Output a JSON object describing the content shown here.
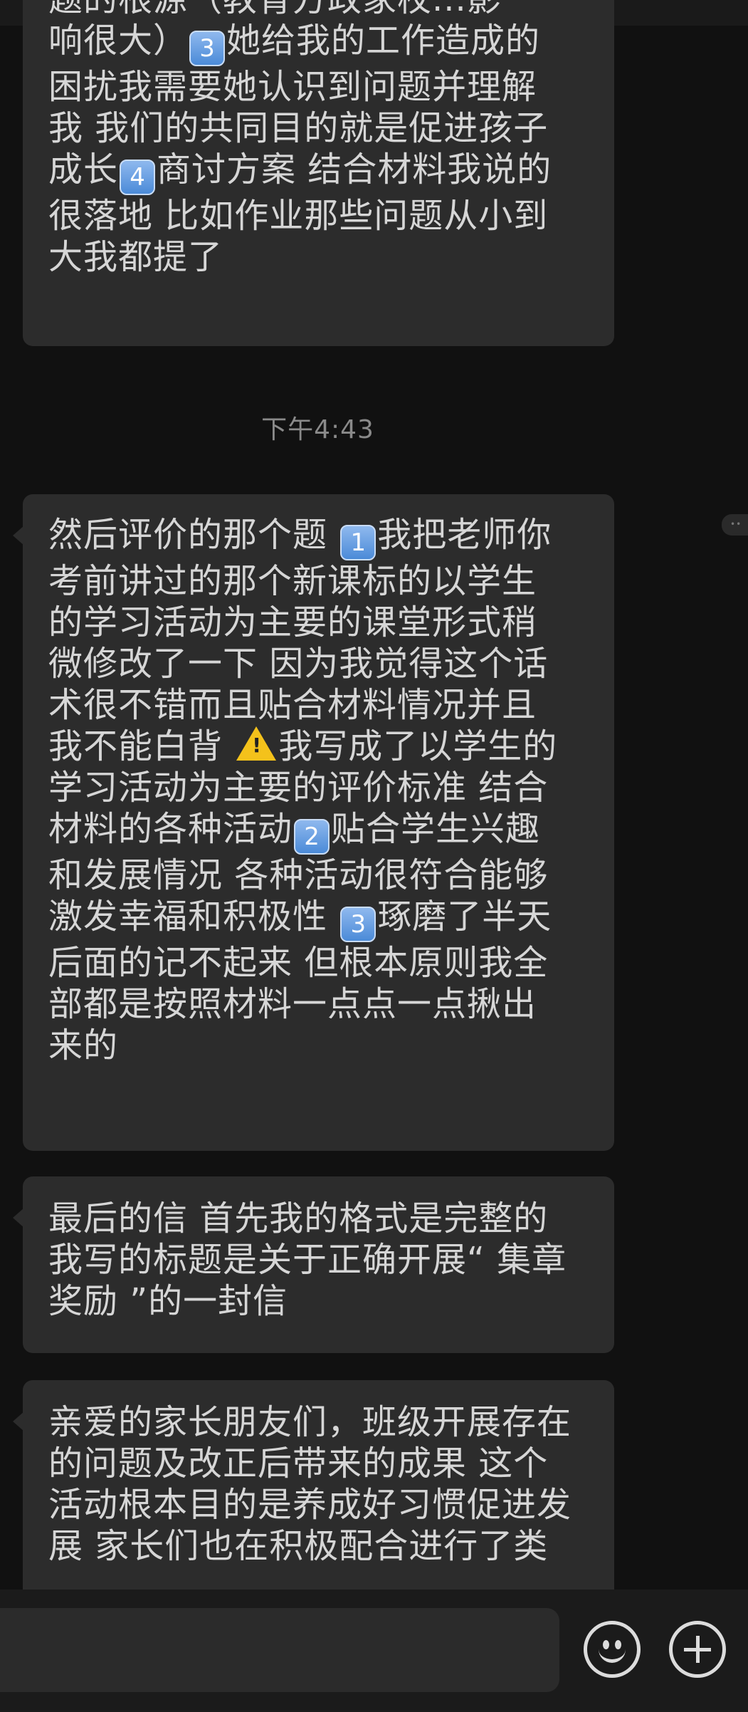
{
  "timestamp": "下午4:43",
  "bubble1": {
    "lines": [
      "题的根源（教育方政家校...影",
      "响很大）",
      "她给我的工作造成的",
      "困扰我需要她认识到问题并理解",
      "我 我们的共同目的就是促进孩子",
      "成长",
      "商讨方案 结合材料我说的",
      "很落地 比如作业那些问题从小到",
      "大我都提了"
    ],
    "kc3": "3",
    "kc4": "4"
  },
  "bubble2": {
    "l1a": "然后评价的那个题 ",
    "l1b": "我把老师你",
    "l2": "考前讲过的那个新课标的以学生",
    "l3": "的学习活动为主要的课堂形式稍",
    "l4": "微修改了一下 因为我觉得这个话",
    "l5": "术很不错而且贴合材料情况并且",
    "l6a": "我不能白背 ",
    "l6b": "我写成了以学生的",
    "l7": "学习活动为主要的评价标准 结合",
    "l8a": "材料的各种活动",
    "l8b": "贴合学生兴趣",
    "l9": "和发展情况 各种活动很符合能够",
    "l10a": "激发幸福和积极性 ",
    "l10b": "琢磨了半天",
    "l11": "后面的记不起来 但根本原则我全",
    "l12": "部都是按照材料一点点一点揪出",
    "l13": "来的",
    "kc1": "1",
    "kc2": "2",
    "kc3": "3",
    "warn": "!"
  },
  "bubble3": {
    "lines": [
      "最后的信 首先我的格式是完整的",
      "我写的标题是关于正确开展“ 集章",
      "奖励 ”的一封信"
    ]
  },
  "bubble4": {
    "lines": [
      "亲爱的家长朋友们，班级开展存在",
      "的问题及改正后带来的成果 这个",
      "活动根本目的是养成好习惯促进发",
      "展 家长们也在积极配合进行了类"
    ]
  },
  "icons": {
    "emoji": "emoji-icon",
    "plus": "plus-icon",
    "warning": "warning-icon",
    "keycap": "keycap-number-icon"
  },
  "colors": {
    "background": "#111111",
    "bubble": "#2c2c2c",
    "text": "#d6d6d6",
    "timestamp": "#8a8a8a",
    "keycap": "#4b8bd8",
    "warning": "#f4c21b"
  }
}
